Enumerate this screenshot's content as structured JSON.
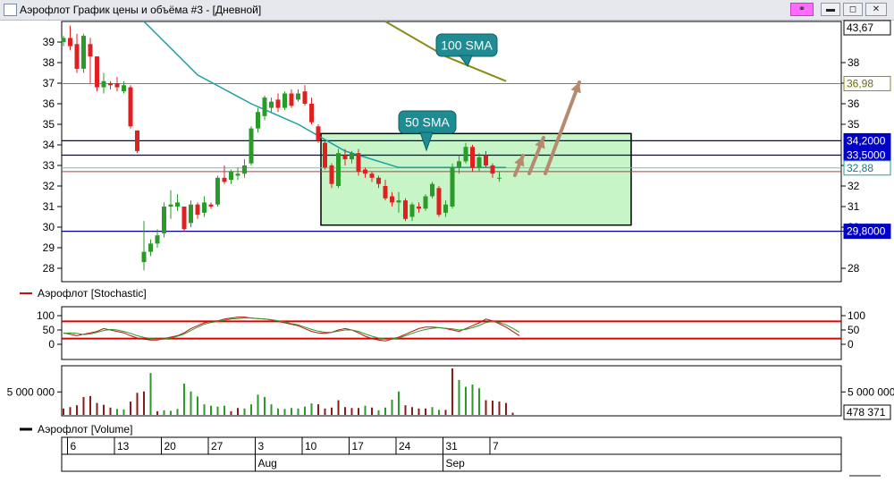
{
  "window": {
    "title": "Аэрофлот График цены и объёма #3 - [Дневной]",
    "pin_icon": "link-icon",
    "min_icon": "minimize-icon",
    "max_icon": "maximize-icon",
    "close_icon": "close-icon"
  },
  "price_panel": {
    "y_ticks": [
      "39",
      "38",
      "37",
      "36",
      "35",
      "34",
      "33",
      "32",
      "31",
      "30",
      "29",
      "28"
    ],
    "right_ticks": [
      "38",
      "37",
      "36",
      "35",
      "33",
      "32",
      "31",
      "30",
      "29,8000",
      "28"
    ],
    "right_badges": [
      {
        "label": "43,67",
        "style": "white"
      },
      {
        "label": "36,98",
        "style": "olive"
      },
      {
        "label": "34,2000",
        "style": "blue"
      },
      {
        "label": "33,5000",
        "style": "blue"
      },
      {
        "label": "32,88",
        "style": "teal"
      },
      {
        "label": "29,8000",
        "style": "blue"
      }
    ],
    "callouts": {
      "sma100": "100 SMA",
      "sma50": "50 SMA"
    },
    "levels": {
      "resistance_1": 34.2,
      "resistance_2": 33.5,
      "support": 29.8,
      "current": 32.88,
      "sma100_end": 36.98,
      "zone_bottom": 30.1
    }
  },
  "stochastic_panel": {
    "legend": "Аэрофлот [Stochastic]",
    "y_ticks": [
      "100",
      "50",
      "0"
    ],
    "levels": [
      80,
      20
    ]
  },
  "volume_panel": {
    "legend": "Аэрофлот [Volume]",
    "y_tick": "5 000 000",
    "right_tick": "5 000 000",
    "last_volume": "478 371"
  },
  "x_axis": {
    "days": [
      "6",
      "13",
      "20",
      "27",
      "3",
      "10",
      "17",
      "24",
      "31",
      "7"
    ],
    "months": [
      "Aug",
      "Sep"
    ]
  },
  "colors": {
    "up": "#2a9a2a",
    "down": "#e02020",
    "volume_down": "#8b1a1a",
    "sma50": "#1a9fa3",
    "sma100": "#8a8a1a",
    "level": "#00008b",
    "zone": "#c8f5c8",
    "arrow": "#b58a6e"
  },
  "chart_data": [
    {
      "type": "candlestick",
      "title": "",
      "ylim": [
        27.5,
        40
      ],
      "candles": [
        [
          39.0,
          39.3,
          38.8,
          39.2
        ],
        [
          39.2,
          39.8,
          38.6,
          38.8
        ],
        [
          38.9,
          39.4,
          37.5,
          37.7
        ],
        [
          37.7,
          39.4,
          37.5,
          39.3
        ],
        [
          38.9,
          39.2,
          37.0,
          38.3
        ],
        [
          38.3,
          38.3,
          36.6,
          36.8
        ],
        [
          36.8,
          37.5,
          36.5,
          37.1
        ],
        [
          37.0,
          37.1,
          36.7,
          36.9
        ],
        [
          37.0,
          37.3,
          36.6,
          36.8
        ],
        [
          36.6,
          37.1,
          36.5,
          36.9
        ],
        [
          36.8,
          36.9,
          34.8,
          34.9
        ],
        [
          34.7,
          34.7,
          33.6,
          33.7
        ],
        [
          28.3,
          30.3,
          27.9,
          28.8
        ],
        [
          28.8,
          29.4,
          28.6,
          29.2
        ],
        [
          29.2,
          29.9,
          29.0,
          29.6
        ],
        [
          29.7,
          31.2,
          29.5,
          31.0
        ],
        [
          31.0,
          31.8,
          30.4,
          31.1
        ],
        [
          31.0,
          31.6,
          30.8,
          31.2
        ],
        [
          31.0,
          31.0,
          29.8,
          29.9
        ],
        [
          30.2,
          31.3,
          30.0,
          31.1
        ],
        [
          31.1,
          31.2,
          30.4,
          30.6
        ],
        [
          30.7,
          31.5,
          30.5,
          31.2
        ],
        [
          31.1,
          31.2,
          30.9,
          31.0
        ],
        [
          31.1,
          32.5,
          31.0,
          32.4
        ],
        [
          32.4,
          33.0,
          32.1,
          32.2
        ],
        [
          32.3,
          32.8,
          32.1,
          32.7
        ],
        [
          32.5,
          32.9,
          32.3,
          32.6
        ],
        [
          32.6,
          33.3,
          32.4,
          33.0
        ],
        [
          33.1,
          34.9,
          33.0,
          34.8
        ],
        [
          34.8,
          35.8,
          34.6,
          35.6
        ],
        [
          35.4,
          36.4,
          35.2,
          36.3
        ],
        [
          35.8,
          36.3,
          35.6,
          36.1
        ],
        [
          36.2,
          36.5,
          35.6,
          35.8
        ],
        [
          35.8,
          36.6,
          35.7,
          36.5
        ],
        [
          36.5,
          36.7,
          35.8,
          35.9
        ],
        [
          36.2,
          36.7,
          36.1,
          36.5
        ],
        [
          36.6,
          36.9,
          35.9,
          36.0
        ],
        [
          36.0,
          36.3,
          35.0,
          35.1
        ],
        [
          34.9,
          35.0,
          34.1,
          34.2
        ],
        [
          34.1,
          34.2,
          32.8,
          32.9
        ],
        [
          33.0,
          33.1,
          31.9,
          32.1
        ],
        [
          32.0,
          33.8,
          31.9,
          33.6
        ],
        [
          33.5,
          33.8,
          33.0,
          33.3
        ],
        [
          33.3,
          33.7,
          33.1,
          33.6
        ],
        [
          33.6,
          33.8,
          32.5,
          32.7
        ],
        [
          32.8,
          32.9,
          32.4,
          32.6
        ],
        [
          32.6,
          32.7,
          32.2,
          32.4
        ],
        [
          32.4,
          32.5,
          31.9,
          32.1
        ],
        [
          32.0,
          32.3,
          31.3,
          31.4
        ],
        [
          31.5,
          31.7,
          31.0,
          31.2
        ],
        [
          31.2,
          31.7,
          30.7,
          31.3
        ],
        [
          31.3,
          31.4,
          30.3,
          30.4
        ],
        [
          30.5,
          31.2,
          30.3,
          31.1
        ],
        [
          31.0,
          31.2,
          30.7,
          30.9
        ],
        [
          30.9,
          31.6,
          30.8,
          31.5
        ],
        [
          31.5,
          32.2,
          31.4,
          32.1
        ],
        [
          31.9,
          32.0,
          30.5,
          30.6
        ],
        [
          30.7,
          31.3,
          30.5,
          31.1
        ],
        [
          31.0,
          33.1,
          30.9,
          32.9
        ],
        [
          32.9,
          33.5,
          32.6,
          33.2
        ],
        [
          33.2,
          34.1,
          33.1,
          33.9
        ],
        [
          33.9,
          34.0,
          32.7,
          32.9
        ],
        [
          32.9,
          33.6,
          32.7,
          33.4
        ],
        [
          33.5,
          33.7,
          32.9,
          33.0
        ],
        [
          33.0,
          33.1,
          32.4,
          32.6
        ],
        [
          32.4,
          32.7,
          32.2,
          32.4
        ]
      ],
      "sma50": [
        [
          12,
          40.0
        ],
        [
          20,
          37.4
        ],
        [
          28,
          36.0
        ],
        [
          35,
          35.0
        ],
        [
          42,
          33.7
        ],
        [
          50,
          32.9
        ],
        [
          60,
          32.9
        ],
        [
          66,
          32.9
        ]
      ],
      "sma100": [
        [
          48,
          40.0
        ],
        [
          57,
          38.3
        ],
        [
          66,
          37.1
        ]
      ]
    },
    {
      "type": "line",
      "title": "",
      "ylim": [
        0,
        100
      ],
      "series": [
        {
          "values": [
            40,
            35,
            30,
            35,
            40,
            45,
            55,
            50,
            45,
            40,
            30,
            22,
            18,
            15,
            15,
            20,
            25,
            30,
            40,
            55,
            65,
            75,
            80,
            82,
            88,
            92,
            95,
            95,
            92,
            90,
            88,
            85,
            80,
            75,
            70,
            65,
            55,
            45,
            40,
            38,
            42,
            50,
            55,
            50,
            40,
            28,
            20,
            15,
            12,
            18,
            25,
            35,
            45,
            55,
            60,
            60,
            58,
            55,
            50,
            45,
            55,
            65,
            75,
            88,
            82,
            72,
            60,
            45,
            30
          ]
        },
        {
          "values": [
            38,
            40,
            38,
            34,
            36,
            42,
            48,
            52,
            50,
            45,
            38,
            30,
            24,
            20,
            18,
            18,
            22,
            28,
            36,
            48,
            60,
            70,
            76,
            80,
            84,
            88,
            90,
            92,
            92,
            90,
            88,
            86,
            82,
            78,
            72,
            68,
            60,
            52,
            46,
            42,
            42,
            46,
            50,
            50,
            45,
            36,
            28,
            22,
            18,
            18,
            22,
            30,
            38,
            46,
            52,
            56,
            58,
            56,
            54,
            50,
            52,
            58,
            66,
            76,
            80,
            76,
            68,
            56,
            42
          ]
        }
      ]
    },
    {
      "type": "bar",
      "title": "",
      "ylim": [
        0,
        10000000
      ],
      "values": [
        1400000,
        1700000,
        2100000,
        3900000,
        4100000,
        2600000,
        2200000,
        1600000,
        1300000,
        1200000,
        2900000,
        4800000,
        5100000,
        9100000,
        800000,
        1000000,
        900000,
        1300000,
        6800000,
        5100000,
        4000000,
        2300000,
        2000000,
        1800000,
        2000000,
        800000,
        1500000,
        1400000,
        2300000,
        4400000,
        3900000,
        2300000,
        1400000,
        1300000,
        1500000,
        1400000,
        1800000,
        2500000,
        2300000,
        1400000,
        1600000,
        3200000,
        1700000,
        1500000,
        1500000,
        2000000,
        1600000,
        1000000,
        1600000,
        3300000,
        5100000,
        2100000,
        1700000,
        1400000,
        1400000,
        1700000,
        1100000,
        1100000,
        10100000,
        7600000,
        6100000,
        6600000,
        5800000,
        3200000,
        3100000,
        2900000,
        2600000,
        478371
      ],
      "colors": [
        "d",
        "d",
        "d",
        "d",
        "d",
        "d",
        "d",
        "d",
        "u",
        "u",
        "d",
        "d",
        "d",
        "u",
        "d",
        "u",
        "u",
        "u",
        "u",
        "u",
        "u",
        "u",
        "u",
        "u",
        "u",
        "d",
        "d",
        "u",
        "u",
        "u",
        "u",
        "u",
        "u",
        "u",
        "u",
        "u",
        "u",
        "u",
        "d",
        "d",
        "d",
        "d",
        "d",
        "d",
        "d",
        "u",
        "d",
        "u",
        "u",
        "u",
        "u",
        "d",
        "d",
        "d",
        "d",
        "u",
        "u",
        "d",
        "d",
        "u",
        "u",
        "u",
        "u",
        "d",
        "d",
        "d",
        "d",
        "d"
      ]
    }
  ]
}
